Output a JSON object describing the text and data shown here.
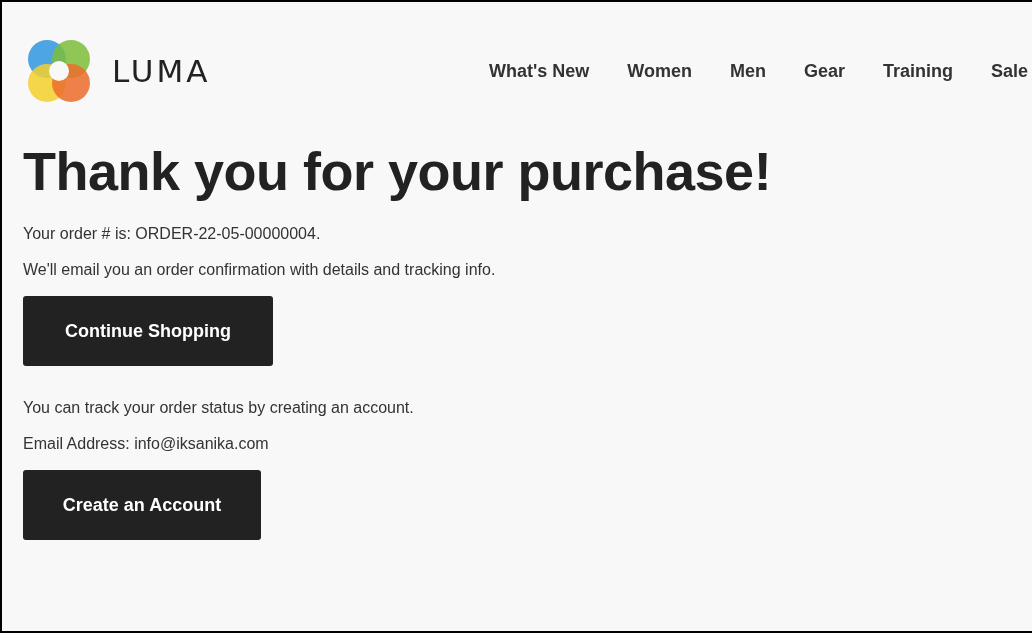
{
  "header": {
    "logo_text": "LUMA",
    "nav": [
      {
        "label": "What's New"
      },
      {
        "label": "Women"
      },
      {
        "label": "Men"
      },
      {
        "label": "Gear"
      },
      {
        "label": "Training"
      },
      {
        "label": "Sale"
      }
    ]
  },
  "main": {
    "title": "Thank you for your purchase!",
    "order_text": "Your order # is: ORDER-22-05-00000004.",
    "email_note": "We'll email you an order confirmation with details and tracking info.",
    "continue_button": "Continue Shopping",
    "account_note": "You can track your order status by creating an account.",
    "email_address": "Email Address: info@iksanika.com",
    "account_button": "Create an Account"
  }
}
